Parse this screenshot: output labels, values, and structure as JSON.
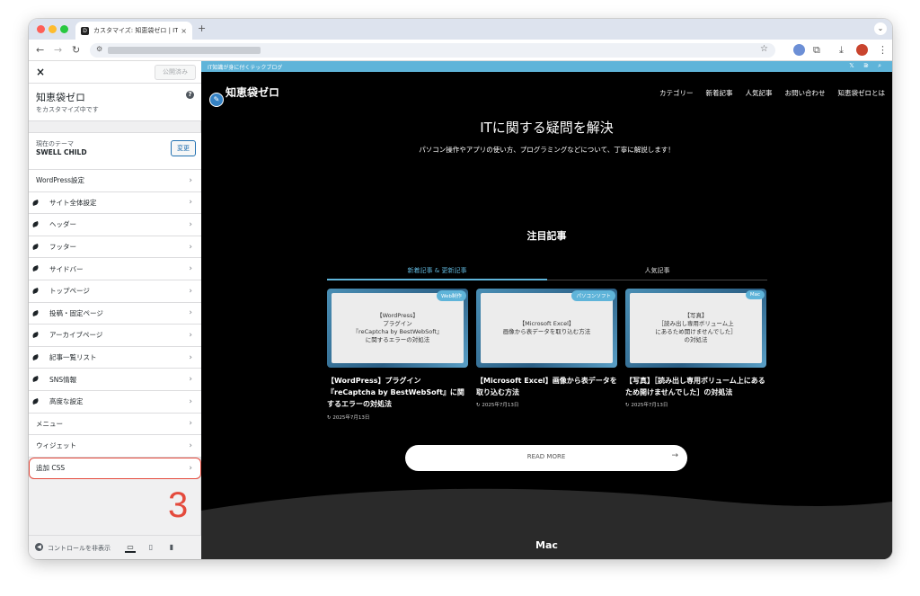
{
  "browser": {
    "tab_favicon": "D",
    "tab_title": "カスタマイズ: 知恵袋ゼロ | IT知識",
    "tab_close": "×",
    "new_tab": "+",
    "tab_dropdown": "⌄",
    "icons": [
      "back-icon",
      "forward-icon",
      "reload-icon",
      "site-info-icon",
      "star-icon",
      "extension-icon",
      "download-icon",
      "profile-icon",
      "menu-icon"
    ]
  },
  "sidebar": {
    "close": "×",
    "publish_label": "公開済み",
    "site_title": "知恵袋ゼロ",
    "site_subtitle": "をカスタマイズ中です",
    "help": "?",
    "theme_label": "現在のテーマ",
    "theme_name": "SWELL CHILD",
    "change_label": "変更",
    "items": [
      {
        "label": "WordPress設定",
        "sub": false
      },
      {
        "label": "サイト全体設定",
        "sub": true
      },
      {
        "label": "ヘッダー",
        "sub": true
      },
      {
        "label": "フッター",
        "sub": true
      },
      {
        "label": "サイドバー",
        "sub": true
      },
      {
        "label": "トップページ",
        "sub": true
      },
      {
        "label": "投稿・固定ページ",
        "sub": true
      },
      {
        "label": "アーカイブページ",
        "sub": true
      },
      {
        "label": "記事一覧リスト",
        "sub": true
      },
      {
        "label": "SNS情報",
        "sub": true
      },
      {
        "label": "高度な設定",
        "sub": true
      },
      {
        "label": "メニュー",
        "sub": false
      },
      {
        "label": "ウィジェット",
        "sub": false
      },
      {
        "label": "追加 CSS",
        "sub": false
      }
    ],
    "step_number": "3",
    "hide_controls": "コントロールを非表示"
  },
  "preview": {
    "tagline": "IT知識が身に付くテックブログ",
    "top_icons": "𝕏 ⋑ ⌕",
    "logo": "知恵袋ゼロ",
    "nav": [
      "カテゴリー",
      "新着記事",
      "人気記事",
      "お問い合わせ",
      "知恵袋ゼロとは"
    ],
    "hero_title": "ITに関する疑問を解決",
    "hero_subtitle": "パソコン操作やアプリの使い方、プログラミングなどについて、丁寧に解説します！",
    "section_title": "注目記事",
    "tabs": [
      "新着記事 & 更新記事",
      "人気記事"
    ],
    "cards": [
      {
        "badge": "Web制作",
        "thumb": "【WordPress】\nプラグイン\n『reCaptcha by BestWebSoft』\nに関するエラーの対処法",
        "title": "【WordPress】プラグイン『reCaptcha by BestWebSoft』に関するエラーの対処法",
        "date": "2025年7月13日"
      },
      {
        "badge": "パソコンソフト",
        "thumb": "【Microsoft Excel】\n画像から表データを取り込む方法",
        "title": "【Microsoft Excel】画像から表データを取り込む方法",
        "date": "2025年7月13日"
      },
      {
        "badge": "Mac",
        "thumb": "【写真】\n［読み出し専用ボリューム上\nにあるため開けませんでした］\nの対処法",
        "title": "【写真】［読み出し専用ボリューム上にあるため開けませんでした］の対処法",
        "date": "2025年7月13日"
      }
    ],
    "read_more": "READ MORE",
    "read_more_arrow": "→",
    "bottom_title": "Mac"
  }
}
